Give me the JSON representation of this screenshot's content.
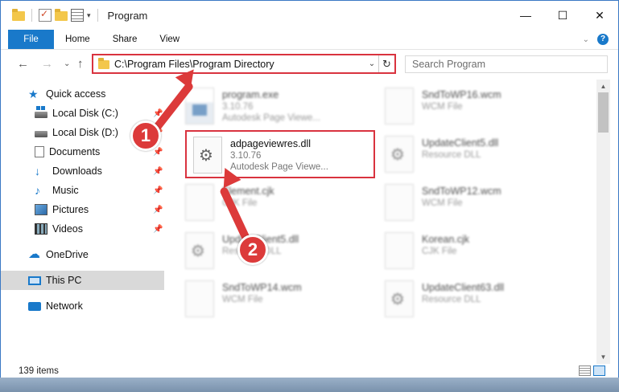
{
  "window": {
    "title": "Program",
    "controls": {
      "minimize": "—",
      "maximize": "☐",
      "close": "✕"
    }
  },
  "ribbon": {
    "file_label": "File",
    "tabs": [
      "Home",
      "Share",
      "View"
    ]
  },
  "address_bar": {
    "path": "C:\\Program Files\\Program Directory",
    "refresh_icon": "↻",
    "dropdown_icon": "⌄"
  },
  "nav": {
    "back": "←",
    "forward": "→",
    "dropdown": "⌄",
    "up": "↑"
  },
  "search": {
    "placeholder": "Search Program"
  },
  "sidebar": {
    "items": [
      {
        "label": "Quick access",
        "icon": "star-icon"
      },
      {
        "label": "Local Disk (C:)",
        "icon": "disk-icon",
        "pinned": true
      },
      {
        "label": "Local Disk (D:)",
        "icon": "disk-icon",
        "pinned": true
      },
      {
        "label": "Documents",
        "icon": "documents-icon",
        "pinned": true
      },
      {
        "label": "Downloads",
        "icon": "downloads-icon",
        "pinned": true
      },
      {
        "label": "Music",
        "icon": "music-icon",
        "pinned": true
      },
      {
        "label": "Pictures",
        "icon": "pictures-icon",
        "pinned": true
      },
      {
        "label": "Videos",
        "icon": "videos-icon",
        "pinned": true
      },
      {
        "label": "OneDrive",
        "icon": "onedrive-icon"
      },
      {
        "label": "This PC",
        "icon": "this-pc-icon",
        "selected": true
      },
      {
        "label": "Network",
        "icon": "network-icon"
      }
    ]
  },
  "files": [
    {
      "name": "program.exe",
      "line1": "3.10.76",
      "line2": "Autodesk Page Viewe...",
      "type": "exe"
    },
    {
      "name": "SndToWP16.wcm",
      "line1": "WCM File",
      "type": "generic"
    },
    {
      "name": "adpageviewres.dll",
      "line1": "3.10.76",
      "line2": "Autodesk Page Viewe...",
      "type": "dll",
      "highlighted": true
    },
    {
      "name": "UpdateClient5.dll",
      "line1": "Resource DLL",
      "type": "dll"
    },
    {
      "name": "Element.cjk",
      "line1": "CJK File",
      "type": "generic"
    },
    {
      "name": "SndToWP12.wcm",
      "line1": "WCM File",
      "type": "generic"
    },
    {
      "name": "UpdateClient5.dll",
      "line1": "Resource DLL",
      "type": "dll"
    },
    {
      "name": "Korean.cjk",
      "line1": "CJK File",
      "type": "generic"
    },
    {
      "name": "SndToWP14.wcm",
      "line1": "WCM File",
      "type": "generic"
    },
    {
      "name": "UpdateClient63.dll",
      "line1": "Resource DLL",
      "type": "dll"
    }
  ],
  "status": {
    "item_count": "139 items"
  },
  "callouts": {
    "one": "1",
    "two": "2"
  },
  "colors": {
    "accent": "#1979ca",
    "callout": "#dc3a3a"
  }
}
